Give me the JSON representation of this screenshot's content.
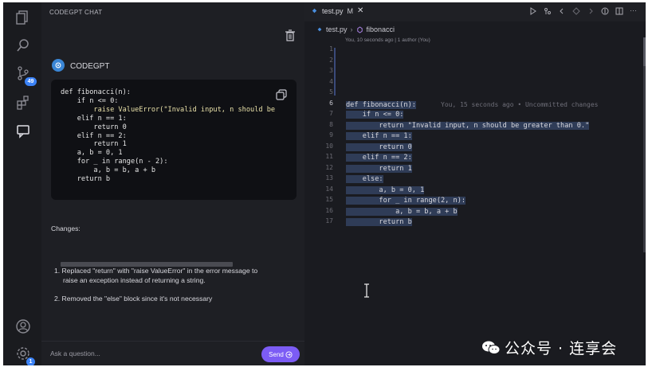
{
  "sidebar": {
    "panel_title": "CODEGPT CHAT",
    "source_control_badge": "49",
    "settings_badge": "1"
  },
  "chat": {
    "assistant_name": "CODEGPT",
    "code_lines": [
      "def fibonacci(n):",
      "    if n <= 0:",
      "        raise ValueError(\"Invalid input, n should be",
      "    elif n == 1:",
      "        return 0",
      "    elif n == 2:",
      "        return 1",
      "    a, b = 0, 1",
      "    for _ in range(n - 2):",
      "        a, b = b, a + b",
      "    return b"
    ],
    "changes_heading": "Changes:",
    "change_items": [
      "1. Replaced \"return\" with \"raise ValueError\" in the error message to",
      "raise an exception instead of returning a string.",
      "2. Removed the \"else\" block since it's not necessary"
    ],
    "input_placeholder": "Ask a question...",
    "send_label": "Send"
  },
  "editor": {
    "tab_name": "test.py",
    "tab_status": "M",
    "breadcrumb_file": "test.py",
    "breadcrumb_symbol": "fibonacci",
    "blame_header": "You, 10 seconds ago | 1 author (You)",
    "inline_blame": "You, 15 seconds ago • Uncommitted changes",
    "line_numbers": [
      "1",
      "2",
      "3",
      "4",
      "5",
      "6",
      "7",
      "8",
      "9",
      "10",
      "11",
      "12",
      "13",
      "14",
      "15",
      "16",
      "17"
    ],
    "active_line": 6,
    "code_lines": [
      "",
      "",
      "",
      "",
      "",
      "def fibonacci(n):",
      "    if n <= 0:",
      "        return \"Invalid input, n should be greater than 0.\"",
      "    elif n == 1:",
      "        return 0",
      "    elif n == 2:",
      "        return 1",
      "    else:",
      "        a, b = 0, 1",
      "        for _ in range(2, n):",
      "            a, b = b, a + b",
      "        return b"
    ]
  },
  "watermark": {
    "text": "公众号 · 连享会"
  },
  "colors": {
    "accent_send": "#7c5cf5",
    "badge_blue": "#3b82f6",
    "selection": "#2f3c57"
  }
}
